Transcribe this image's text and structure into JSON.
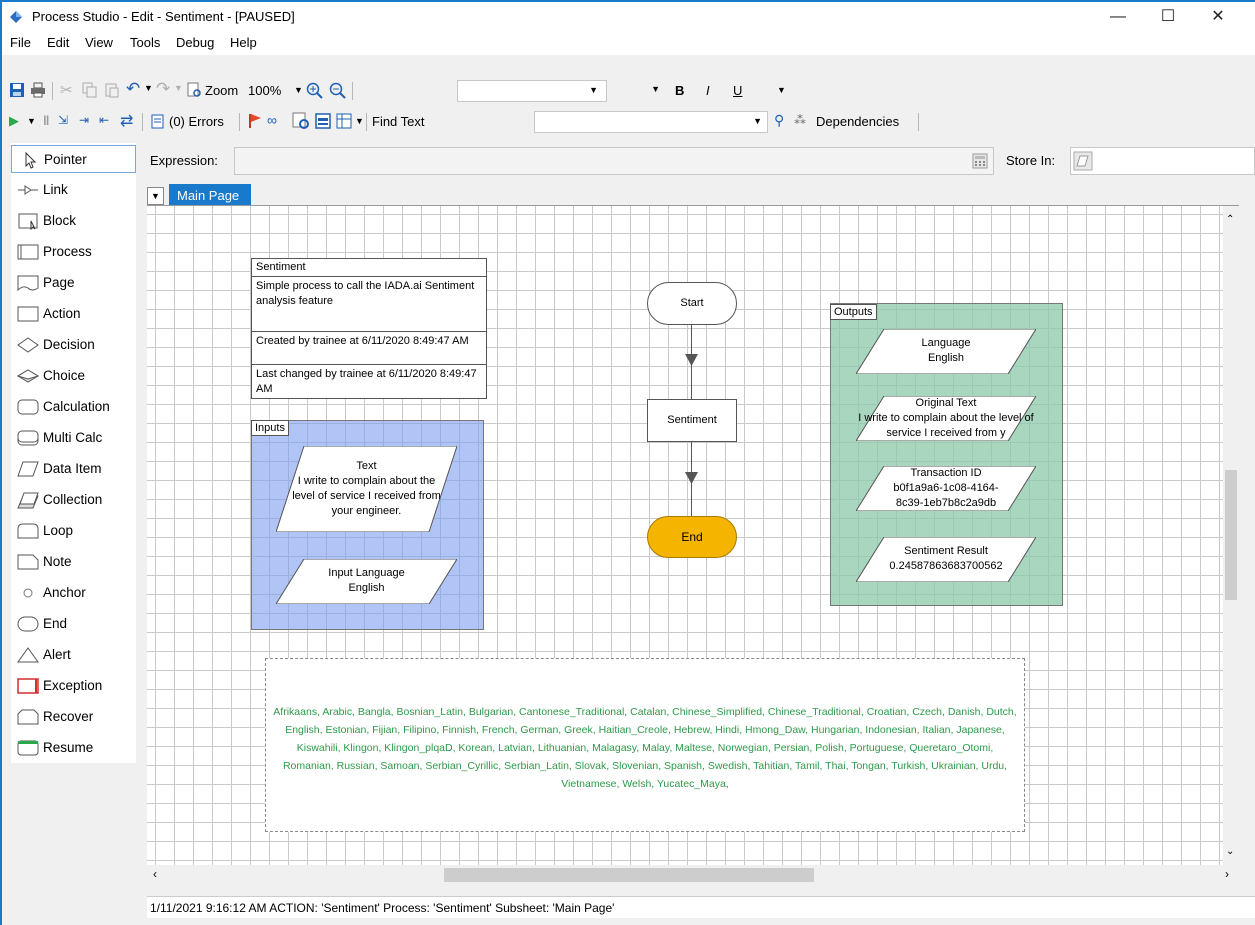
{
  "window": {
    "title": "Process Studio  - Edit - Sentiment - [PAUSED]"
  },
  "menu": [
    "File",
    "Edit",
    "View",
    "Tools",
    "Debug",
    "Help"
  ],
  "toolbar": {
    "zoom_label": "Zoom",
    "zoom_value": "100%",
    "bold": "B",
    "italic": "I",
    "underline": "U",
    "errors_label": "(0) Errors",
    "find_text_label": "Find Text",
    "dependencies_label": "Dependencies"
  },
  "expression_bar": {
    "expression_label": "Expression:",
    "store_in_label": "Store In:"
  },
  "tabs": {
    "main_page": "Main Page"
  },
  "toolbox": [
    "Pointer",
    "Link",
    "Block",
    "Process",
    "Page",
    "Action",
    "Decision",
    "Choice",
    "Calculation",
    "Multi Calc",
    "Data Item",
    "Collection",
    "Loop",
    "Note",
    "Anchor",
    "End",
    "Alert",
    "Exception",
    "Recover",
    "Resume"
  ],
  "info_box": {
    "name": "Sentiment",
    "description": "Simple process to call the IADA.ai Sentiment analysis feature",
    "created": "Created by trainee at 6/11/2020 8:49:47 AM",
    "changed": "Last changed by trainee at 6/11/2020 8:49:47 AM"
  },
  "inputs_block": {
    "label": "Inputs",
    "text_item": {
      "name": "Text",
      "value": "I write to complain about the level of service I received from your engineer."
    },
    "lang_item": {
      "name": "Input Language",
      "value": "English"
    }
  },
  "flow": {
    "start": "Start",
    "action": "Sentiment",
    "end": "End"
  },
  "outputs_block": {
    "label": "Outputs",
    "language": {
      "name": "Language",
      "value": "English"
    },
    "original_text": {
      "name": "Original Text",
      "value": "I write to complain about the level of service I received from y"
    },
    "transaction_id": {
      "name": "Transaction ID",
      "value": "b0f1a9a6-1c08-4164-8c39-1eb7b8c2a9db"
    },
    "sentiment_result": {
      "name": "Sentiment Result",
      "value": "0.24587863683700562"
    }
  },
  "note": "Afrikaans, Arabic, Bangla, Bosnian_Latin, Bulgarian, Cantonese_Traditional, Catalan, Chinese_Simplified, Chinese_Traditional, Croatian, Czech, Danish, Dutch, English, Estonian, Fijian, Filipino, Finnish, French, German, Greek, Haitian_Creole, Hebrew, Hindi, Hmong_Daw, Hungarian, Indonesian, Italian, Japanese, Kiswahili, Klingon, Klingon_plqaD, Korean, Latvian, Lithuanian, Malagasy, Malay, Maltese, Norwegian, Persian, Polish, Portuguese, Queretaro_Otomi, Romanian, Russian, Samoan, Serbian_Cyrillic, Serbian_Latin, Slovak, Slovenian, Spanish, Swedish, Tahitian, Tamil, Thai, Tongan, Turkish, Ukrainian, Urdu, Vietnamese, Welsh, Yucatec_Maya,",
  "status": "1/11/2021 9:16:12 AM ACTION: 'Sentiment' Process: 'Sentiment' Subsheet: 'Main Page'",
  "colors": {
    "accent": "#1979ca",
    "inputs_fill": "#aec5f7",
    "outputs_fill": "#a9d5bf",
    "end_fill": "#f5b400",
    "note_text": "#2e9a4a"
  }
}
